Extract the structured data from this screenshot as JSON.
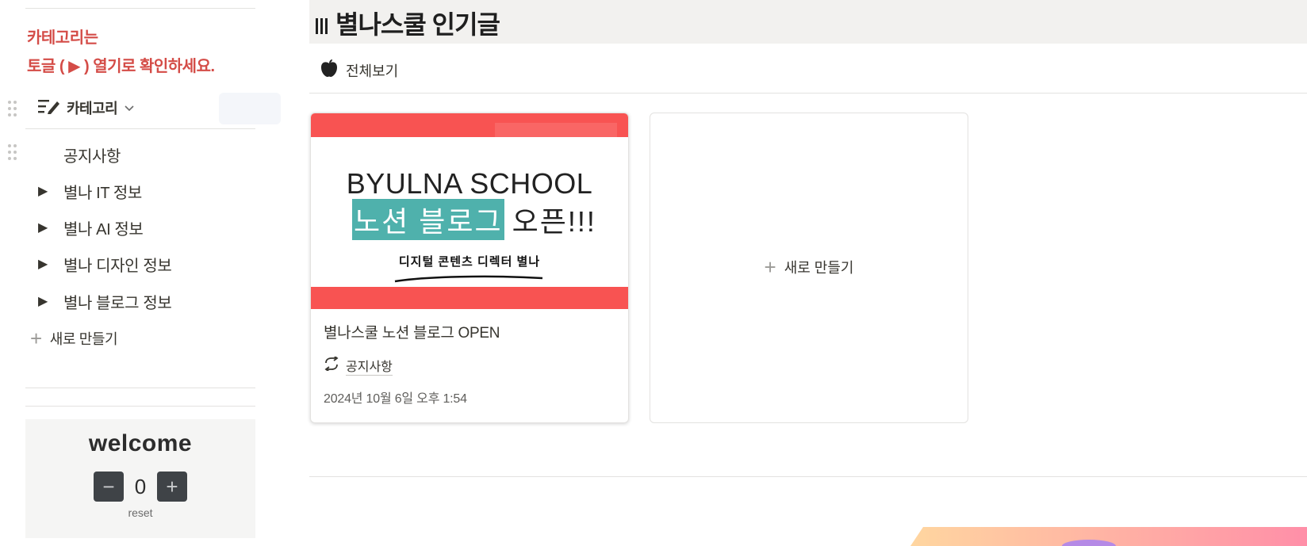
{
  "sidebar": {
    "notice_line1": "카테고리는",
    "notice_line2": "토글 ( ▶ ) 열기로 확인하세요.",
    "database_title": "카테고리",
    "database_icon": "edit-list-icon",
    "categories": [
      {
        "label": "공지사항",
        "toggle": false
      },
      {
        "label": "별나 IT 정보",
        "toggle": true
      },
      {
        "label": "별나 AI 정보",
        "toggle": true
      },
      {
        "label": "별나 디자인 정보",
        "toggle": true
      },
      {
        "label": "별나 블로그 정보",
        "toggle": true
      }
    ],
    "toggle_glyph": "▶",
    "new_label": "새로 만들기",
    "widget": {
      "title": "welcome",
      "minus": "−",
      "count": "0",
      "plus": "+",
      "reset": "reset"
    }
  },
  "main": {
    "title": "별나스쿨 인기글",
    "view_tab": "전체보기",
    "view_icon": "apple-icon",
    "cards": [
      {
        "cover_line1": "BYULNA SCHOOL",
        "cover_line2_highlight": "노션 블로그",
        "cover_line2_rest": "오픈!!!",
        "cover_line3": "디지털 콘텐츠 디렉터 별나",
        "title": "별나스쿨 노션 블로그 OPEN",
        "relation": "공지사항",
        "relation_icon": "relation-arrows-icon",
        "date": "2024년 10월 6일 오후 1:54"
      }
    ],
    "new_card_label": "새로 만들기"
  },
  "colors": {
    "notice_red": "#d44c47",
    "cover_red": "#f85352",
    "highlight_teal": "#4fb1ac",
    "title_bar": "#f2f1ef"
  }
}
